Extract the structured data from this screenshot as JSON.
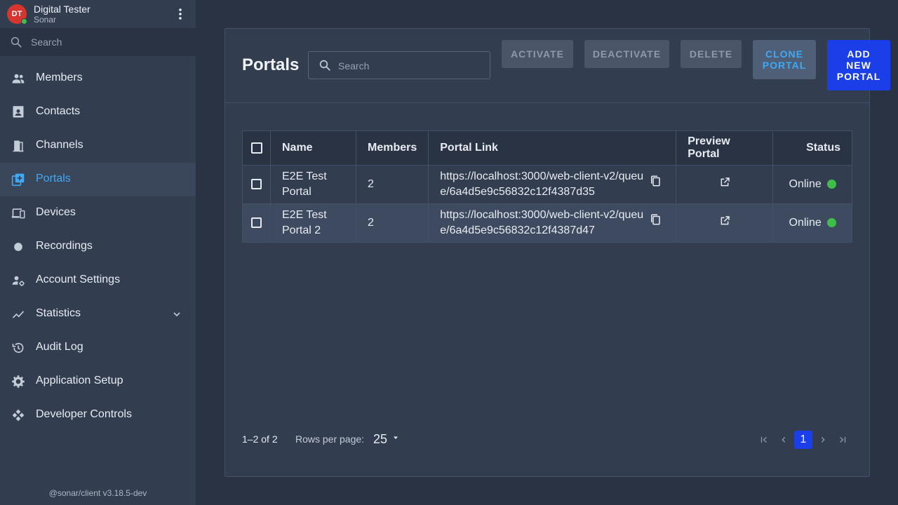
{
  "user": {
    "initials": "DT",
    "name": "Digital Tester",
    "org": "Sonar"
  },
  "sidebar": {
    "search_placeholder": "Search",
    "items": [
      {
        "label": "Members",
        "icon": "people-icon"
      },
      {
        "label": "Contacts",
        "icon": "contact-card-icon"
      },
      {
        "label": "Channels",
        "icon": "door-icon"
      },
      {
        "label": "Portals",
        "icon": "portal-add-icon",
        "active": true
      },
      {
        "label": "Devices",
        "icon": "devices-icon"
      },
      {
        "label": "Recordings",
        "icon": "record-dot-icon"
      },
      {
        "label": "Account Settings",
        "icon": "user-gear-icon"
      },
      {
        "label": "Statistics",
        "icon": "trend-line-icon",
        "expandable": true
      },
      {
        "label": "Audit Log",
        "icon": "history-icon"
      },
      {
        "label": "Application Setup",
        "icon": "gear-icon"
      },
      {
        "label": "Developer Controls",
        "icon": "developer-icon"
      }
    ],
    "version": "@sonar/client v3.18.5-dev"
  },
  "main": {
    "title": "Portals",
    "search_placeholder": "Search",
    "buttons": {
      "activate": "ACTIVATE",
      "deactivate": "DEACTIVATE",
      "delete": "DELETE",
      "clone_line1": "CLONE",
      "clone_line2": "PORTAL",
      "add_line1": "ADD",
      "add_line2": "NEW",
      "add_line3": "PORTAL"
    },
    "table": {
      "columns": [
        "Name",
        "Members",
        "Portal Link",
        "Preview Portal",
        "Status"
      ],
      "rows": [
        {
          "name": "E2E Test Portal",
          "members": "2",
          "link": "https://localhost:3000/web-client-v2/queue/6a4d5e9c56832c12f4387d35",
          "status": "Online"
        },
        {
          "name": "E2E Test Portal 2",
          "members": "2",
          "link": "https://localhost:3000/web-client-v2/queue/6a4d5e9c56832c12f4387d47",
          "status": "Online"
        }
      ]
    },
    "pagination": {
      "range": "1–2 of 2",
      "rows_per_page_label": "Rows per page:",
      "rows_per_page": "25",
      "current_page": "1"
    }
  },
  "colors": {
    "accent_blue": "#1a3ee8",
    "active_link": "#3fa9f5",
    "online": "#3fbf4a",
    "avatar": "#d7362f"
  }
}
